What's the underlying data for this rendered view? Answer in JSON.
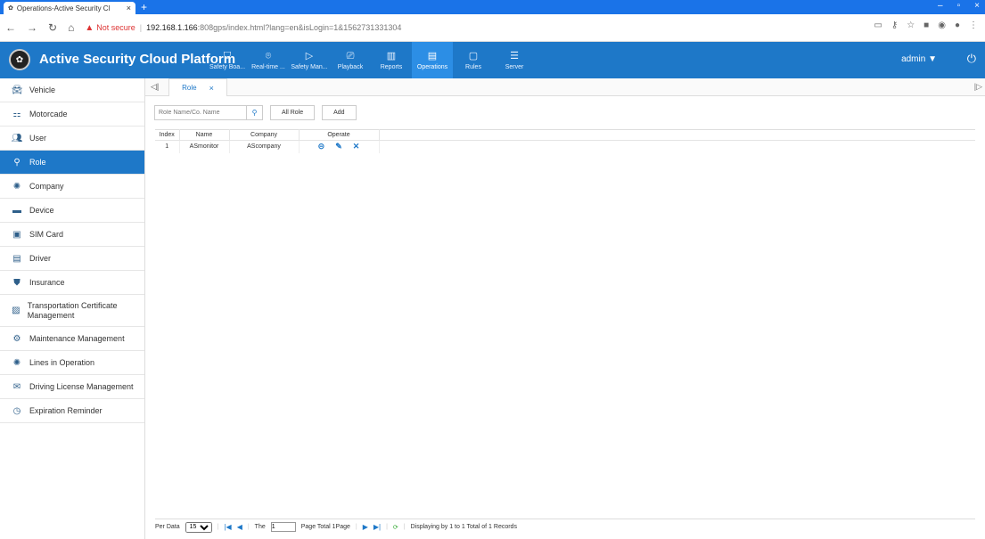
{
  "browser": {
    "tab_title": "Operations-Active Security Cl",
    "new_tab": "+",
    "address": {
      "warning": "Not secure",
      "host": "192.168.1.166",
      "path": ":808gps/index.html?lang=en&isLogin=1&1562731331304"
    }
  },
  "app": {
    "title": "Active Security Cloud Platform",
    "menu": [
      {
        "label": "Safety Boa...",
        "icon": "shield-icon"
      },
      {
        "label": "Real-time ...",
        "icon": "location-pin-icon"
      },
      {
        "label": "Safety Man...",
        "icon": "shield-play-icon"
      },
      {
        "label": "Playback",
        "icon": "playback-icon"
      },
      {
        "label": "Reports",
        "icon": "bar-chart-icon"
      },
      {
        "label": "Operations",
        "icon": "operations-icon",
        "active": true
      },
      {
        "label": "Rules",
        "icon": "window-icon"
      },
      {
        "label": "Server",
        "icon": "sliders-icon"
      }
    ],
    "user": "admin",
    "user_caret": "▼",
    "power": "⏻"
  },
  "sidebar": {
    "items": [
      {
        "label": "Vehicle",
        "icon": "car-icon"
      },
      {
        "label": "Motorcade",
        "icon": "motorcade-icon"
      },
      {
        "label": "User",
        "icon": "users-icon"
      },
      {
        "label": "Role",
        "icon": "key-icon",
        "active": true
      },
      {
        "label": "Company",
        "icon": "company-icon"
      },
      {
        "label": "Device",
        "icon": "device-icon"
      },
      {
        "label": "SIM Card",
        "icon": "sim-card-icon"
      },
      {
        "label": "Driver",
        "icon": "driver-icon"
      },
      {
        "label": "Insurance",
        "icon": "insurance-icon"
      },
      {
        "label": "Transportation Certificate Management",
        "icon": "certificate-icon"
      },
      {
        "label": "Maintenance Management",
        "icon": "gears-icon"
      },
      {
        "label": "Lines in Operation",
        "icon": "lines-icon"
      },
      {
        "label": "Driving License Management",
        "icon": "mail-icon"
      },
      {
        "label": "Expiration Reminder",
        "icon": "clock-icon"
      }
    ]
  },
  "page_tab": {
    "label": "Role",
    "close": "×"
  },
  "toolbar": {
    "search_placeholder": "Role Name/Co. Name",
    "all_role_label": "All Role",
    "add_label": "Add"
  },
  "table": {
    "headers": [
      "Index",
      "Name",
      "Company",
      "Operate"
    ],
    "rows": [
      {
        "index": "1",
        "name": "ASmonitor",
        "company": "AScompany"
      }
    ]
  },
  "pager": {
    "per_data_label": "Per Data",
    "per_data_value": "15",
    "the_label": "The",
    "page_value": "1",
    "page_total": "Page Total 1Page",
    "summary": "Displaying by 1 to 1 Total of 1 Records"
  },
  "colors": {
    "accent": "#1e78c8",
    "active_menu": "#2c8ee5",
    "browser": "#1a73e8"
  }
}
